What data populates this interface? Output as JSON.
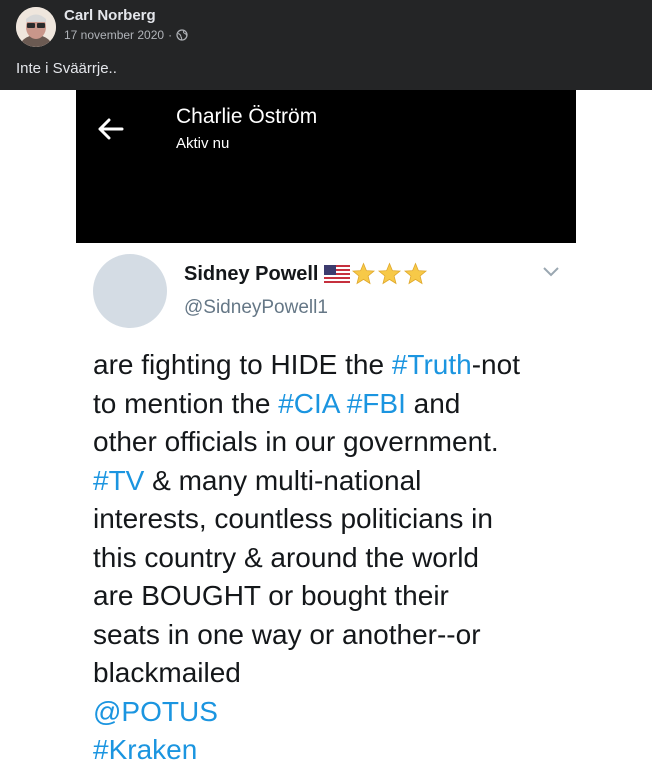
{
  "post": {
    "author": "Carl Norberg",
    "date": "17 november 2020",
    "separator": "·",
    "privacy_icon": "globe-icon",
    "text": "Inte i Sväärrje.."
  },
  "screenshot": {
    "chat": {
      "back_icon": "arrow-left-icon",
      "contact_name": "Charlie Öström",
      "status": "Aktiv nu"
    },
    "tweet": {
      "name": "Sidney Powell",
      "badges": [
        "us-flag-icon",
        "star-icon",
        "star-icon",
        "star-icon"
      ],
      "handle": "@SidneyPowell1",
      "menu_icon": "chevron-down-icon",
      "lines": [
        [
          {
            "t": "are fighting to HIDE the "
          },
          {
            "t": "#Truth",
            "h": true
          },
          {
            "t": "-not"
          }
        ],
        [
          {
            "t": "to mention the "
          },
          {
            "t": "#CIA",
            "h": true
          },
          {
            "t": " "
          },
          {
            "t": "#FBI",
            "h": true
          },
          {
            "t": " and"
          }
        ],
        [
          {
            "t": "other officials in our government."
          }
        ],
        [
          {
            "t": "#TV",
            "h": true
          },
          {
            "t": " & many multi-national"
          }
        ],
        [
          {
            "t": "interests, countless politicians in"
          }
        ],
        [
          {
            "t": "this country & around the world"
          }
        ],
        [
          {
            "t": "are BOUGHT or bought their"
          }
        ],
        [
          {
            "t": "seats in one way or another--or"
          }
        ],
        [
          {
            "t": "blackmailed"
          }
        ],
        [
          {
            "t": "@POTUS",
            "h": true
          }
        ],
        [
          {
            "t": "#Kraken",
            "h": true
          }
        ]
      ]
    }
  },
  "colors": {
    "facebook_dark": "#242526",
    "link_blue": "#1b95e0",
    "chat_bar": "#000000",
    "text": "#14171a"
  }
}
